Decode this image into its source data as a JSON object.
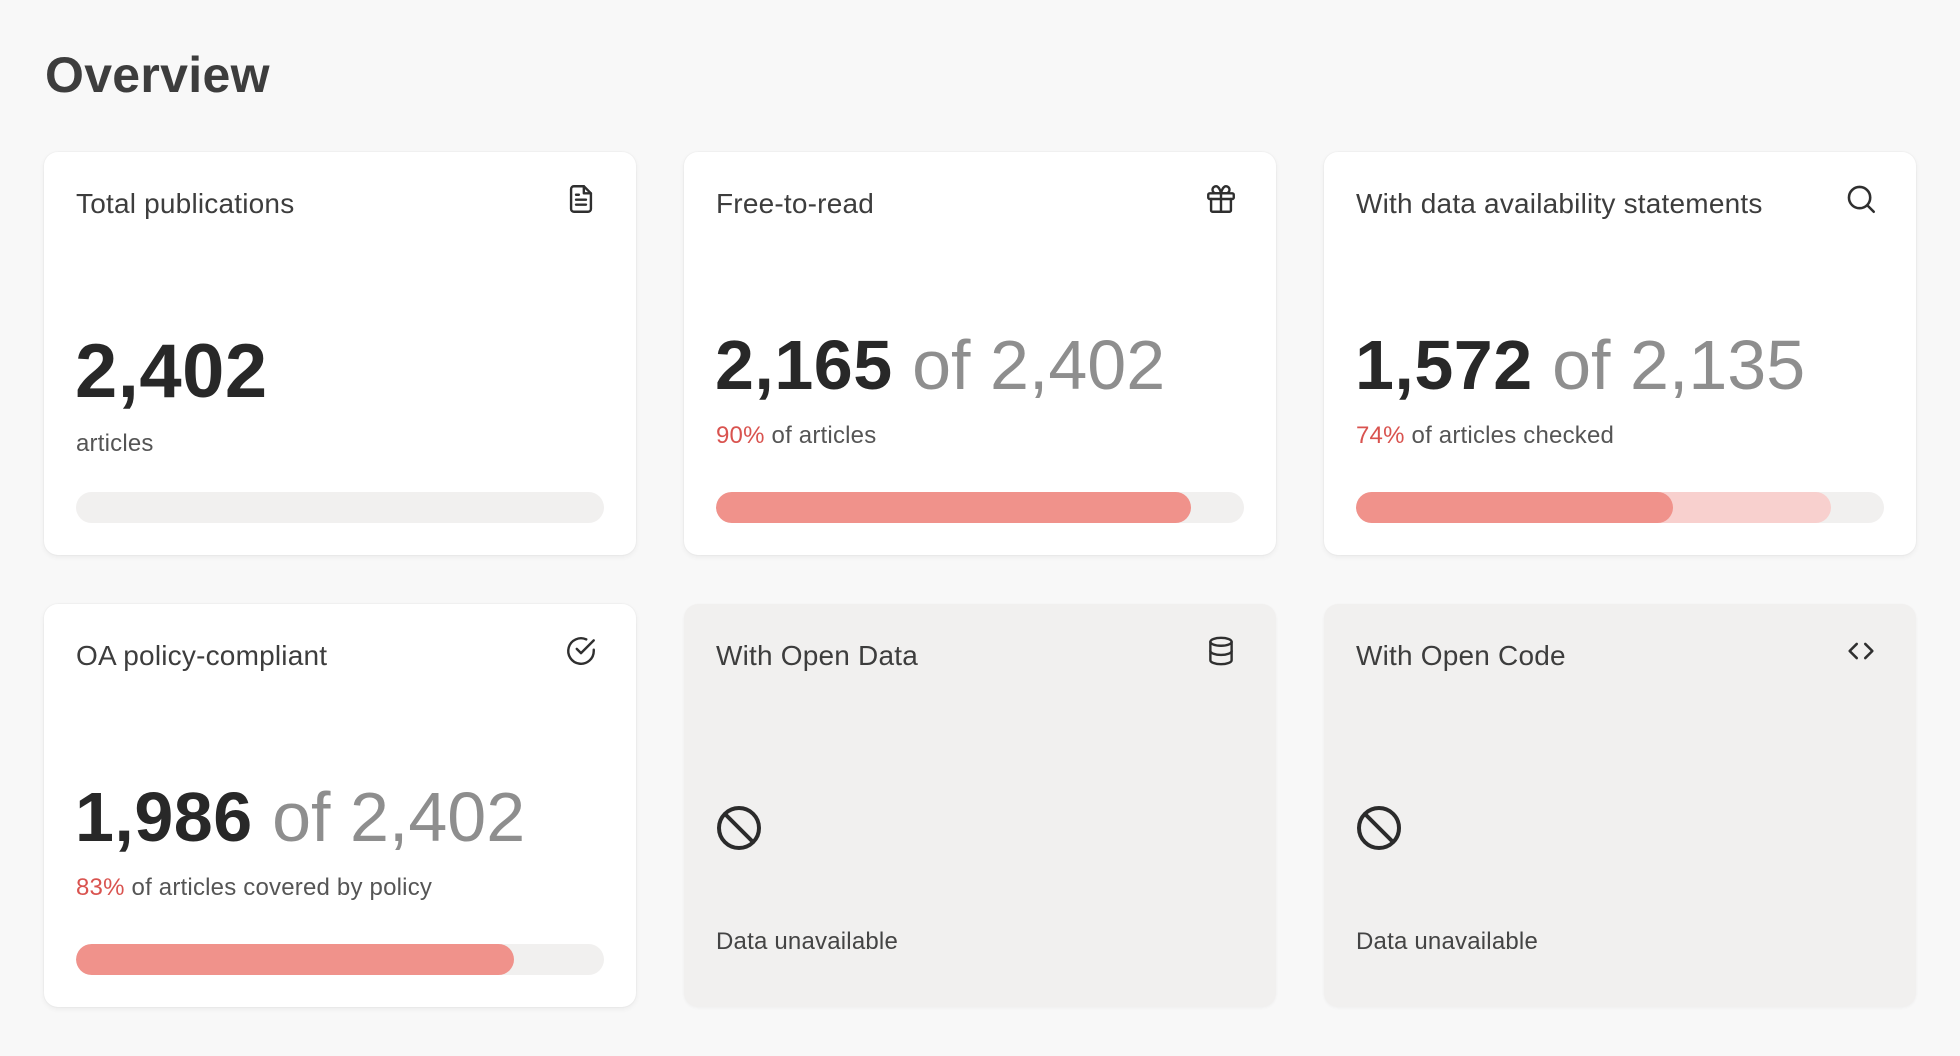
{
  "page": {
    "title": "Overview"
  },
  "cards": [
    {
      "title": "Total publications",
      "icon": "document-icon",
      "value": "2,402",
      "subtitle": "articles",
      "progress": null
    },
    {
      "title": "Free-to-read",
      "icon": "gift-icon",
      "value": "2,165",
      "of_text": "of 2,402",
      "percent": "90%",
      "subtitle": "of articles",
      "progress": 0.9
    },
    {
      "title": "With data availability statements",
      "icon": "search-icon",
      "value": "1,572",
      "of_text": "of 2,135",
      "percent": "74%",
      "subtitle": "of articles checked",
      "progress": 0.6,
      "progress_secondary": 0.9
    },
    {
      "title": "OA policy-compliant",
      "icon": "check-circle-icon",
      "value": "1,986",
      "of_text": "of 2,402",
      "percent": "83%",
      "subtitle": "of articles covered by policy",
      "progress": 0.83
    },
    {
      "title": "With Open Data",
      "icon": "database-icon",
      "status_icon": "unavailable-icon",
      "status_text": "Data unavailable"
    },
    {
      "title": "With Open Code",
      "icon": "code-icon",
      "status_icon": "unavailable-icon",
      "status_text": "Data unavailable"
    }
  ],
  "colors": {
    "accent_fill": "#f0928b",
    "accent_fill_light": "#f8d0ce",
    "percent_text": "#d9534f",
    "track": "#f1f0ef",
    "disabled_card": "#f1f0ef"
  }
}
